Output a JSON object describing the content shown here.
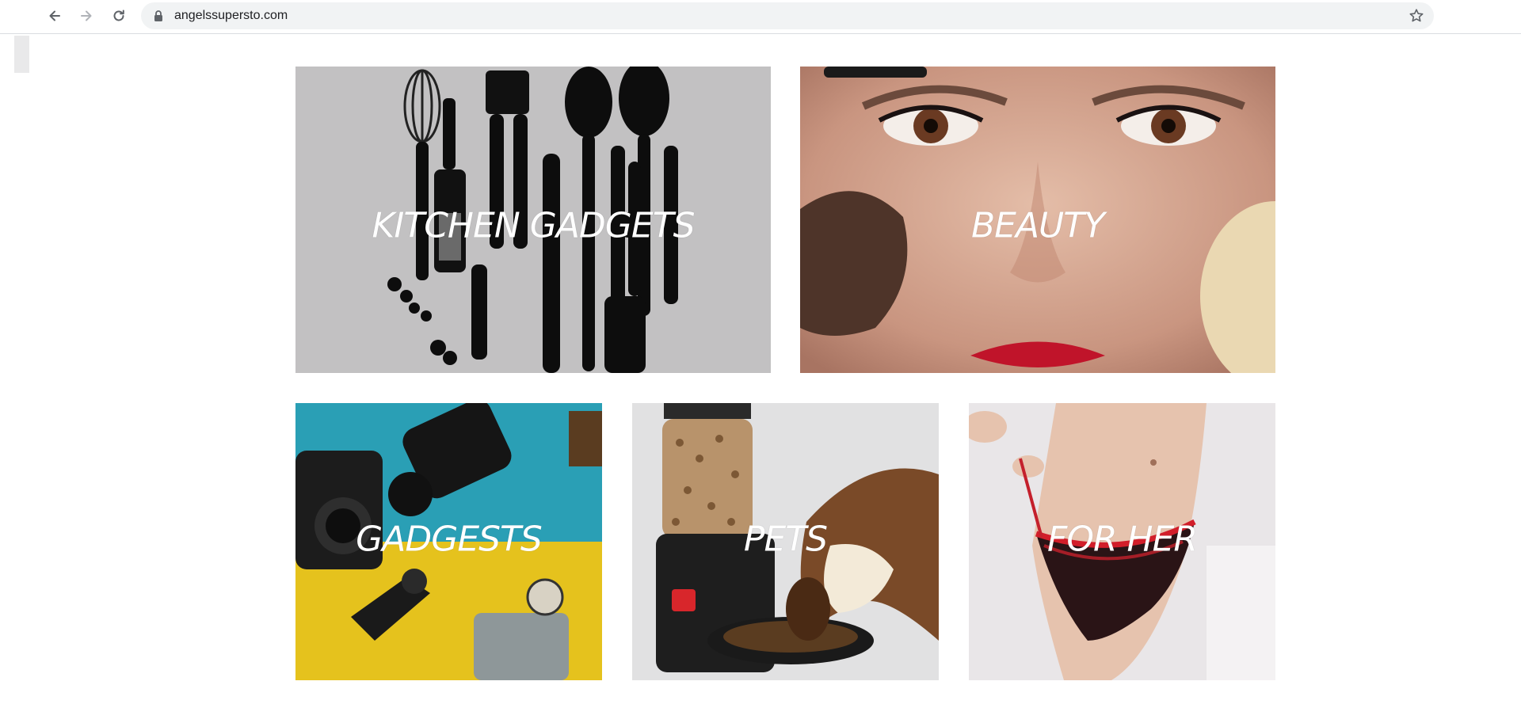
{
  "browser": {
    "url": "angelssupersto.com",
    "icons": {
      "back": "arrow-left-icon",
      "forward": "arrow-right-icon",
      "reload": "reload-icon",
      "lock": "lock-icon",
      "bookmark": "star-icon"
    }
  },
  "categories": [
    {
      "label": "KITCHEN GADGETS",
      "image": "kitchen-utensils"
    },
    {
      "label": "BEAUTY",
      "image": "makeup-face"
    },
    {
      "label": "GADGESTS",
      "image": "camera-gadgets"
    },
    {
      "label": "PETS",
      "image": "pet-feeder-dog"
    },
    {
      "label": "FOR HER",
      "image": "lingerie"
    }
  ],
  "colors": {
    "kitchen_bg": "#c2c1c2",
    "beauty_skin": "#d2a48e",
    "gadgets_blue": "#2a9fb5",
    "gadgets_yellow": "#e5c21d",
    "pets_bg": "#e1e1e2",
    "forher_bg": "#e9e6e8"
  }
}
